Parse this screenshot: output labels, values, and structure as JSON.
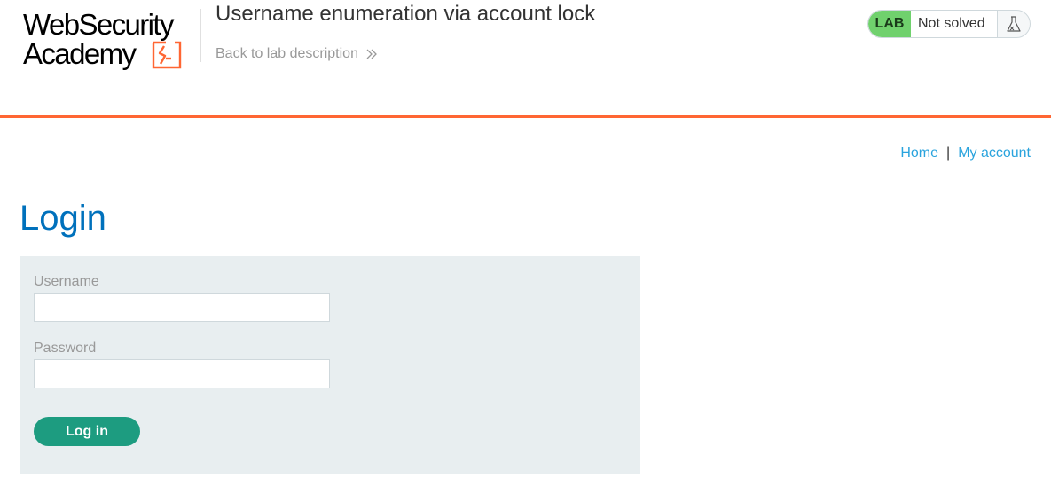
{
  "header": {
    "logo_line1": "WebSecurity",
    "logo_line2": "Academy",
    "lab_title": "Username enumeration via account lock",
    "back_link": "Back to lab description",
    "status": {
      "badge": "LAB",
      "text": "Not solved",
      "icon": "flask-icon"
    }
  },
  "nav": {
    "home": "Home",
    "separator": "|",
    "my_account": "My account"
  },
  "page": {
    "title": "Login"
  },
  "form": {
    "username_label": "Username",
    "username_value": "",
    "password_label": "Password",
    "password_value": "",
    "submit_label": "Log in"
  },
  "colors": {
    "accent_orange": "#ff6633",
    "title_blue": "#0071bc",
    "link_blue": "#29a3dd",
    "lab_green": "#70d16d",
    "button_green": "#1d9c80",
    "panel_bg": "#e8eef0"
  }
}
